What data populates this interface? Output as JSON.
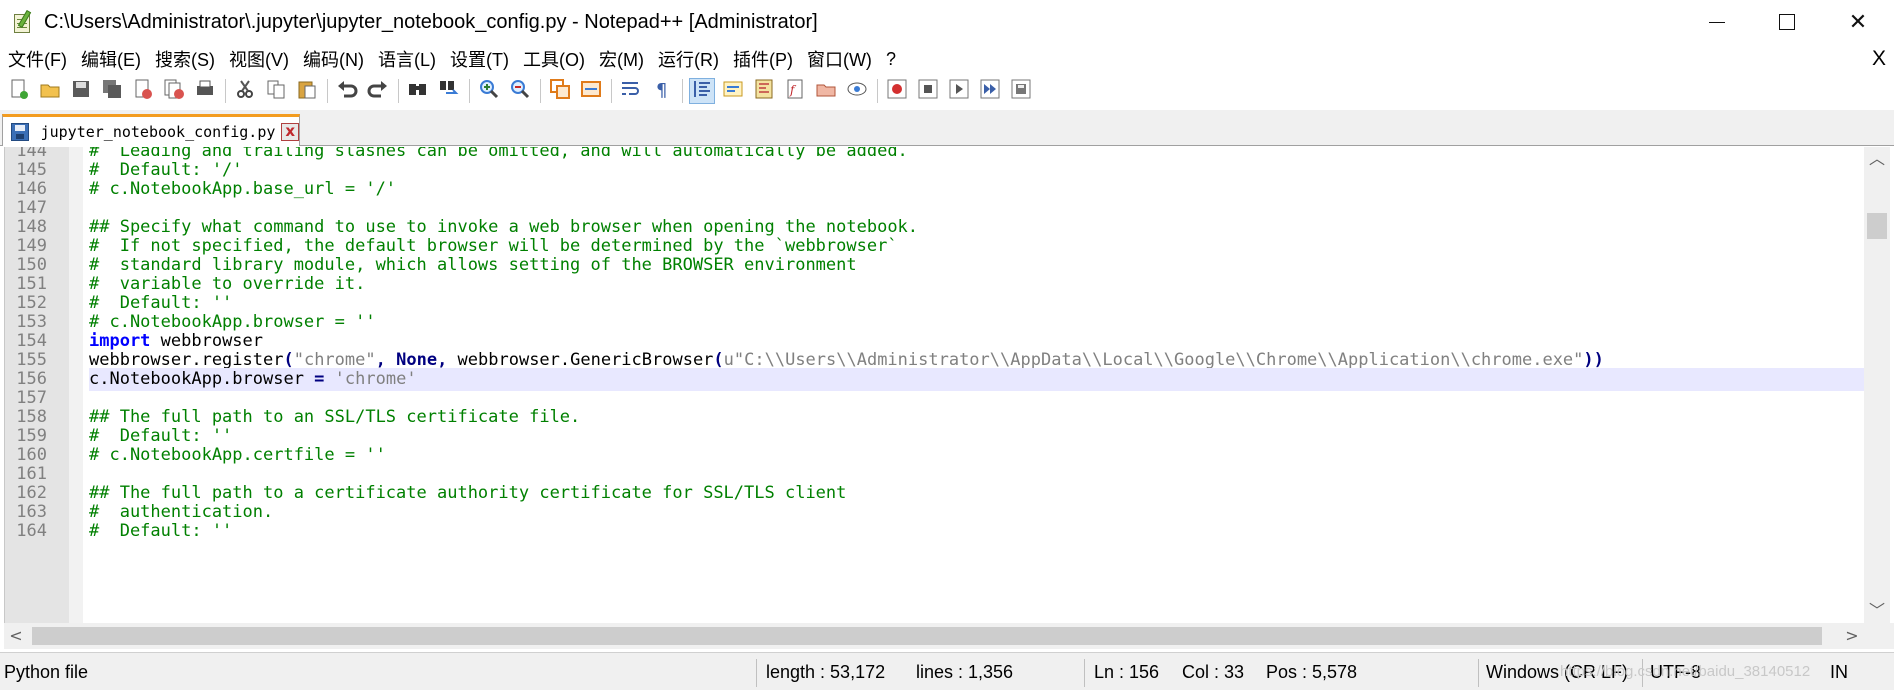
{
  "window": {
    "title": "C:\\Users\\Administrator\\.jupyter\\jupyter_notebook_config.py - Notepad++ [Administrator]",
    "minimize": "—",
    "maximize": "☐",
    "close": "✕"
  },
  "menu": {
    "items": [
      "文件(F)",
      "编辑(E)",
      "搜索(S)",
      "视图(V)",
      "编码(N)",
      "语言(L)",
      "设置(T)",
      "工具(O)",
      "宏(M)",
      "运行(R)",
      "插件(P)",
      "窗口(W)",
      "?"
    ],
    "close": "X"
  },
  "toolbar": {
    "buttons": [
      "new-file",
      "open-file",
      "save",
      "save-all",
      "close",
      "close-all",
      "print",
      "cut",
      "copy",
      "paste",
      "undo",
      "redo",
      "find",
      "replace",
      "zoom-in",
      "zoom-out",
      "sync-vertical",
      "sync-horizontal",
      "word-wrap",
      "show-all-chars",
      "indent-guide",
      "user-defined-language",
      "document-map",
      "function-list",
      "folder-as-workspace",
      "monitoring",
      "record-macro",
      "stop-recording",
      "play-macro",
      "run-macro-multiple",
      "save-macro"
    ]
  },
  "tab": {
    "label": "jupyter_notebook_config.py",
    "close": "x",
    "accent": "#f39c1f"
  },
  "editor": {
    "lines": [
      {
        "n": "144",
        "tokens": [
          [
            "comment",
            "#  Leading and trailing slashes can be omitted, and will automatically be added."
          ]
        ]
      },
      {
        "n": "145",
        "tokens": [
          [
            "comment",
            "#  Default: '/'"
          ]
        ]
      },
      {
        "n": "146",
        "tokens": [
          [
            "comment",
            "# c.NotebookApp.base_url = '/'"
          ]
        ]
      },
      {
        "n": "147",
        "tokens": []
      },
      {
        "n": "148",
        "tokens": [
          [
            "comment",
            "## Specify what command to use to invoke a web browser when opening the notebook."
          ]
        ]
      },
      {
        "n": "149",
        "tokens": [
          [
            "comment",
            "#  If not specified, the default browser will be determined by the `webbrowser`"
          ]
        ]
      },
      {
        "n": "150",
        "tokens": [
          [
            "comment",
            "#  standard library module, which allows setting of the BROWSER environment"
          ]
        ]
      },
      {
        "n": "151",
        "tokens": [
          [
            "comment",
            "#  variable to override it."
          ]
        ]
      },
      {
        "n": "152",
        "tokens": [
          [
            "comment",
            "#  Default: ''"
          ]
        ]
      },
      {
        "n": "153",
        "tokens": [
          [
            "comment",
            "# c.NotebookApp.browser = ''"
          ]
        ]
      },
      {
        "n": "154",
        "tokens": [
          [
            "kw",
            "import"
          ],
          [
            "plain",
            " webbrowser"
          ]
        ]
      },
      {
        "n": "155",
        "tokens": [
          [
            "plain",
            "webbrowser.register"
          ],
          [
            "op",
            "("
          ],
          [
            "str",
            "\"chrome\""
          ],
          [
            "op",
            ","
          ],
          [
            "plain",
            " "
          ],
          [
            "none",
            "None"
          ],
          [
            "op",
            ","
          ],
          [
            "plain",
            " webbrowser.GenericBrowser"
          ],
          [
            "op",
            "("
          ],
          [
            "str",
            "u\"C:\\\\Users\\\\Administrator\\\\AppData\\\\Local\\\\Google\\\\Chrome\\\\Application\\\\chrome.exe\""
          ],
          [
            "op",
            "))"
          ]
        ]
      },
      {
        "n": "156",
        "current": true,
        "tokens": [
          [
            "plain",
            "c.NotebookApp.browser "
          ],
          [
            "op",
            "="
          ],
          [
            "plain",
            " "
          ],
          [
            "str",
            "'chrome'"
          ]
        ]
      },
      {
        "n": "157",
        "tokens": []
      },
      {
        "n": "158",
        "tokens": [
          [
            "comment",
            "## The full path to an SSL/TLS certificate file."
          ]
        ]
      },
      {
        "n": "159",
        "tokens": [
          [
            "comment",
            "#  Default: ''"
          ]
        ]
      },
      {
        "n": "160",
        "tokens": [
          [
            "comment",
            "# c.NotebookApp.certfile = ''"
          ]
        ]
      },
      {
        "n": "161",
        "tokens": []
      },
      {
        "n": "162",
        "tokens": [
          [
            "comment",
            "## The full path to a certificate authority certificate for SSL/TLS client"
          ]
        ]
      },
      {
        "n": "163",
        "tokens": [
          [
            "comment",
            "#  authentication."
          ]
        ]
      },
      {
        "n": "164",
        "tokens": [
          [
            "comment",
            "#  Default: ''"
          ]
        ]
      }
    ]
  },
  "scroll": {
    "up": "︿",
    "down": "﹀",
    "left": "<",
    "right": ">"
  },
  "status": {
    "file_type": "Python file",
    "length": "length : 53,172",
    "lines": "lines : 1,356",
    "ln": "Ln : 156",
    "col": "Col : 33",
    "pos": "Pos : 5,578",
    "eol": "Windows (CR LF)",
    "encoding": "UTF-8",
    "ins": "IN",
    "watermark": "https://blog.csdn.net/baidu_38140512"
  }
}
